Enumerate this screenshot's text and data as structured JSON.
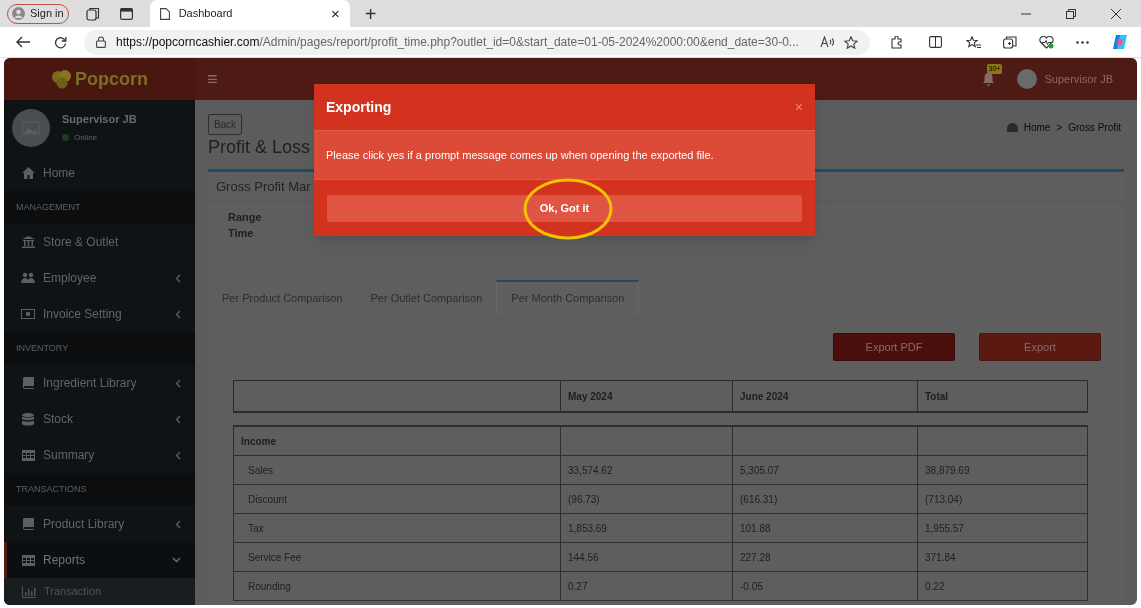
{
  "browser": {
    "sign_in": "Sign in",
    "tab": {
      "title": "Dashboard",
      "close": "×"
    },
    "new_tab": "+",
    "url_host": "https://popcorncashier.com",
    "url_path": "/Admin/pages/report/profit_time.php?outlet_id=0&start_date=01-05-2024%2000:00&end_date=30-0..."
  },
  "header": {
    "logo": "Popcorn",
    "menu_icon": "≡",
    "notification_badge": "30+",
    "user": "Supervisor JB"
  },
  "sidebar": {
    "user": {
      "name": "Supervisor JB",
      "status": "Online"
    },
    "items": [
      {
        "kind": "item",
        "label": "Home",
        "has_submenu": false,
        "selected": false
      },
      {
        "kind": "section",
        "label": "MANAGEMENT"
      },
      {
        "kind": "item",
        "label": "Store & Outlet",
        "has_submenu": false,
        "selected": false
      },
      {
        "kind": "item",
        "label": "Employee",
        "has_submenu": true,
        "expanded": false,
        "selected": false
      },
      {
        "kind": "item",
        "label": "Invoice Setting",
        "has_submenu": true,
        "expanded": false,
        "selected": false
      },
      {
        "kind": "section",
        "label": "INVENTORY"
      },
      {
        "kind": "item",
        "label": "Ingredient Library",
        "has_submenu": true,
        "expanded": false,
        "selected": false
      },
      {
        "kind": "item",
        "label": "Stock",
        "has_submenu": true,
        "expanded": false,
        "selected": false
      },
      {
        "kind": "item",
        "label": "Summary",
        "has_submenu": true,
        "expanded": false,
        "selected": false
      },
      {
        "kind": "section",
        "label": "TRANSACTIONS"
      },
      {
        "kind": "item",
        "label": "Product Library",
        "has_submenu": true,
        "expanded": false,
        "selected": false
      },
      {
        "kind": "item",
        "label": "Reports",
        "has_submenu": true,
        "expanded": true,
        "selected": true,
        "children": [
          {
            "label": "Transaction"
          }
        ]
      }
    ]
  },
  "content": {
    "back": "Back",
    "title": "Profit & Loss",
    "breadcrumb": [
      "Home",
      ">",
      "Gross Profit"
    ],
    "panel_title": "Gross Profit Mar",
    "range_label": "Range Time",
    "tabs": [
      {
        "label": "Per Product Comparison",
        "selected": false
      },
      {
        "label": "Per Outlet Comparison",
        "selected": false
      },
      {
        "label": "Per Month Comparison",
        "selected": true
      }
    ],
    "buttons": [
      {
        "label": "Export PDF",
        "kind": "dark"
      },
      {
        "label": "Export",
        "kind": "primary"
      }
    ],
    "table": {
      "columns": [
        "",
        "May 2024",
        "June 2024",
        "Total"
      ],
      "rows": [
        {
          "kind": "section",
          "cells": [
            "Income",
            "",
            "",
            ""
          ]
        },
        {
          "kind": "row",
          "cells": [
            "Sales",
            "33,574.62",
            "5,305.07",
            "38,879.69"
          ]
        },
        {
          "kind": "row",
          "cells": [
            "Discount",
            "(96.73)",
            "(616.31)",
            "(713.04)"
          ]
        },
        {
          "kind": "row",
          "cells": [
            "Tax",
            "1,853.69",
            "101.88",
            "1,955.57"
          ]
        },
        {
          "kind": "row",
          "cells": [
            "Service Fee",
            "144.56",
            "227.28",
            "371.84"
          ]
        },
        {
          "kind": "row",
          "cells": [
            "Rounding",
            "0.27",
            "-0.05",
            "0.22"
          ]
        }
      ]
    }
  },
  "modal": {
    "title": "Exporting",
    "close": "×",
    "message": "Please click yes if a prompt message comes up when opening the exported file.",
    "button": "Ok, Got it",
    "highlighted": true
  }
}
